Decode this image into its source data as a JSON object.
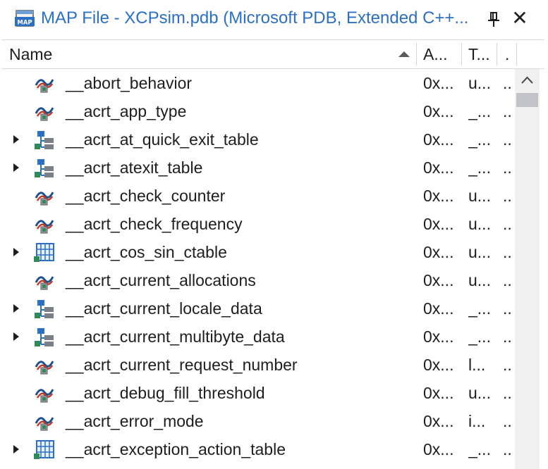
{
  "window": {
    "title": "MAP File - XCPsim.pdb (Microsoft PDB, Extended C++...",
    "accent": "#2b70c4",
    "icons": {
      "app": "map-file-icon",
      "pin": "pin-icon",
      "close": "close-icon"
    },
    "close_glyph": "✕"
  },
  "columns": [
    {
      "label": "Name",
      "sort": "ascending"
    },
    {
      "label": "A..."
    },
    {
      "label": "T..."
    },
    {
      "label": "."
    }
  ],
  "rows": [
    {
      "name": "__abort_behavior",
      "icon": "variable-icon",
      "expandable": false,
      "address": "0x...",
      "type": "u...",
      "extra": ".."
    },
    {
      "name": "__acrt_app_type",
      "icon": "variable-icon",
      "expandable": false,
      "address": "0x...",
      "type": "_...",
      "extra": ".."
    },
    {
      "name": "__acrt_at_quick_exit_table",
      "icon": "structure-icon",
      "expandable": true,
      "address": "0x...",
      "type": "_...",
      "extra": ".."
    },
    {
      "name": "__acrt_atexit_table",
      "icon": "structure-icon",
      "expandable": true,
      "address": "0x...",
      "type": "_...",
      "extra": ".."
    },
    {
      "name": "__acrt_check_counter",
      "icon": "variable-icon",
      "expandable": false,
      "address": "0x...",
      "type": "u...",
      "extra": ".."
    },
    {
      "name": "__acrt_check_frequency",
      "icon": "variable-icon",
      "expandable": false,
      "address": "0x...",
      "type": "u...",
      "extra": ".."
    },
    {
      "name": "__acrt_cos_sin_ctable",
      "icon": "array-icon",
      "expandable": true,
      "address": "0x...",
      "type": "u...",
      "extra": ".."
    },
    {
      "name": "__acrt_current_allocations",
      "icon": "variable-icon",
      "expandable": false,
      "address": "0x...",
      "type": "u...",
      "extra": ".."
    },
    {
      "name": "__acrt_current_locale_data",
      "icon": "structure-icon",
      "expandable": true,
      "address": "0x...",
      "type": "_...",
      "extra": ".."
    },
    {
      "name": "__acrt_current_multibyte_data",
      "icon": "structure-icon",
      "expandable": true,
      "address": "0x...",
      "type": "_...",
      "extra": ".."
    },
    {
      "name": "__acrt_current_request_number",
      "icon": "variable-icon",
      "expandable": false,
      "address": "0x...",
      "type": "l...",
      "extra": ".."
    },
    {
      "name": "__acrt_debug_fill_threshold",
      "icon": "variable-icon",
      "expandable": false,
      "address": "0x...",
      "type": "u...",
      "extra": ".."
    },
    {
      "name": "__acrt_error_mode",
      "icon": "variable-icon",
      "expandable": false,
      "address": "0x...",
      "type": "i...",
      "extra": ".."
    },
    {
      "name": "__acrt_exception_action_table",
      "icon": "array-icon",
      "expandable": true,
      "address": "0x...",
      "type": "_...",
      "extra": ".."
    },
    {
      "name": "",
      "icon": "structure-icon",
      "expandable": false,
      "address": "",
      "type": "",
      "extra": ""
    }
  ]
}
